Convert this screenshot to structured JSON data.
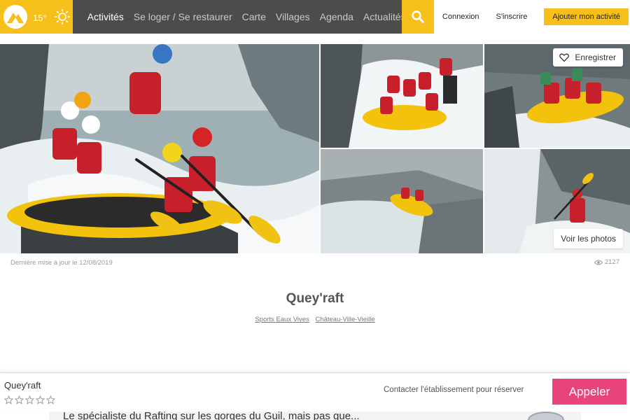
{
  "header": {
    "temperature": "15°",
    "nav": [
      {
        "label": "Activités",
        "active": true
      },
      {
        "label": "Se loger / Se restaurer",
        "active": false
      },
      {
        "label": "Carte",
        "active": false
      },
      {
        "label": "Villages",
        "active": false
      },
      {
        "label": "Agenda",
        "active": false
      },
      {
        "label": "Actualités",
        "active": false
      }
    ],
    "login": "Connexion",
    "signup": "S'inscrire",
    "add_activity": "Ajouter mon activité",
    "icons": [
      "mountain-logo-icon",
      "sun-icon",
      "search-icon"
    ]
  },
  "gallery": {
    "save_label": "Enregistrer",
    "photos_label": "Voir les photos",
    "icons": [
      "heart-icon"
    ]
  },
  "meta": {
    "updated": "Dernière mise à jour le 12/08/2019",
    "views": "2127",
    "icons": [
      "eye-icon"
    ]
  },
  "listing": {
    "title": "Quey'raft",
    "tags": [
      "Sports Eaux Vives",
      "Château-Ville-Vieille"
    ]
  },
  "sticky": {
    "name": "Quey'raft",
    "rating_stars": 0,
    "contact_text": "Contacter l'établissement pour réserver",
    "call_label": "Appeler"
  },
  "teaser": {
    "text": "Le spécialiste du Rafting sur les gorges du Guil, mais pas que..."
  },
  "colors": {
    "brand_yellow": "#f7bf1a",
    "nav_dark": "#4d4c4c",
    "call_pink": "#e8437b"
  }
}
